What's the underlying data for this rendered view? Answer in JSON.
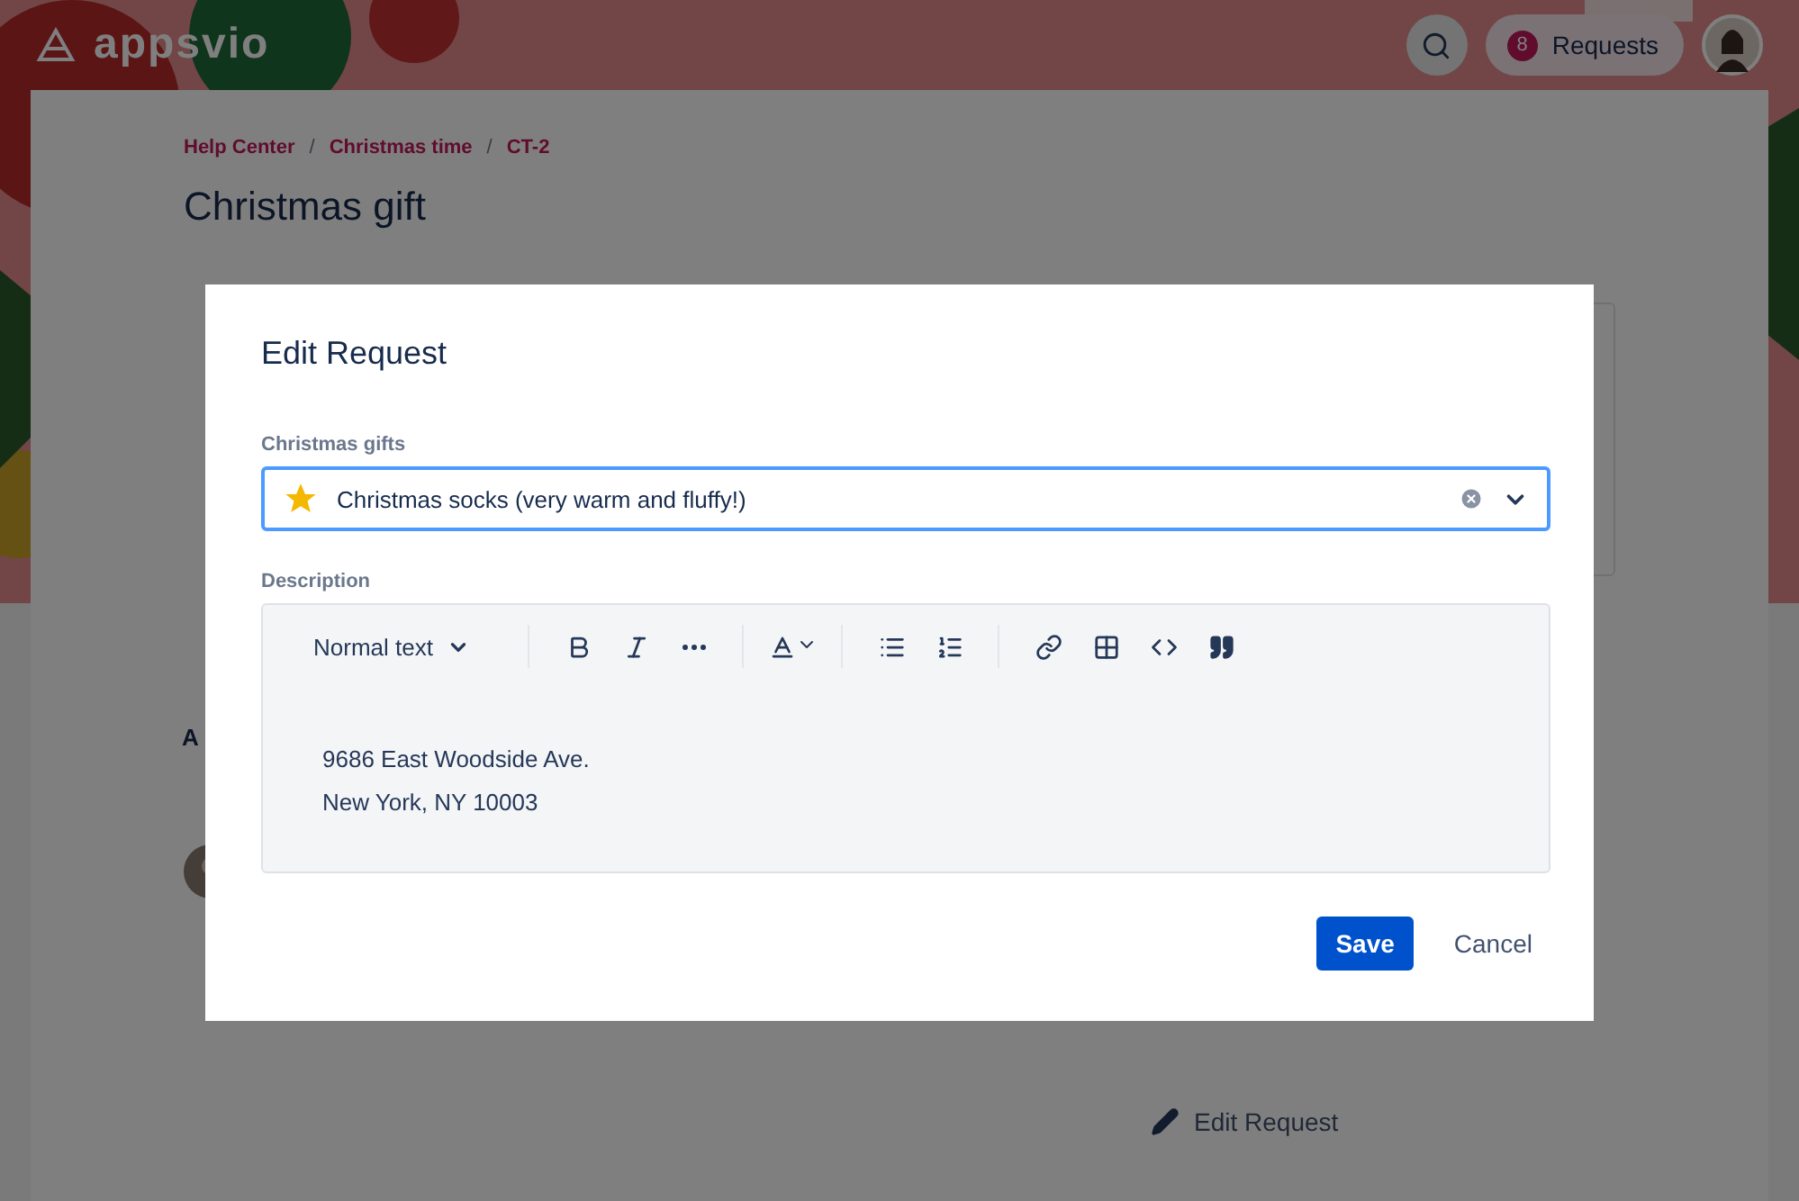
{
  "header": {
    "logo": "appsvio",
    "requests": {
      "count": "8",
      "label": "Requests"
    }
  },
  "breadcrumbs": {
    "separator": "/",
    "items": [
      "Help Center",
      "Christmas time",
      "CT-2"
    ]
  },
  "title": "Christmas gift",
  "page": {
    "section_heading": "A",
    "edit_link": "Edit Request"
  },
  "dialog": {
    "title": "Edit Request",
    "gift_field": {
      "label": "Christmas gifts",
      "value": "Christmas socks (very warm and fluffy!)"
    },
    "description": {
      "label": "Description",
      "style": "Normal text",
      "tools": [
        {
          "kind": "bold"
        },
        {
          "kind": "italic"
        },
        {
          "kind": "more"
        },
        {
          "kind": "sep"
        },
        {
          "kind": "color"
        },
        {
          "kind": "sep"
        },
        {
          "kind": "bullets"
        },
        {
          "kind": "numbers"
        },
        {
          "kind": "sep"
        },
        {
          "kind": "link"
        },
        {
          "kind": "table"
        },
        {
          "kind": "code"
        },
        {
          "kind": "quote"
        }
      ],
      "lines": [
        "9686 East Woodside Ave.",
        "New York, NY 10003"
      ]
    },
    "buttons": {
      "save": "Save",
      "cancel": "Cancel"
    }
  }
}
